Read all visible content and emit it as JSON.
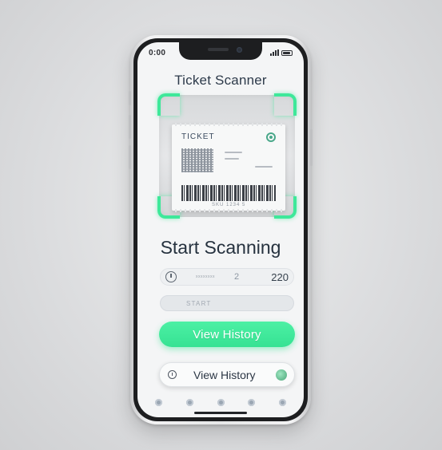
{
  "status_bar": {
    "time": "0:00",
    "icons": [
      "signal-icon",
      "battery-icon"
    ]
  },
  "app": {
    "title": "Ticket Scanner"
  },
  "scanner": {
    "ticket_label": "TICKET",
    "barcode_digits": "SKU 1234 5"
  },
  "headline": "Start Scanning",
  "info_row": {
    "label": "xxxxxxxx",
    "count": "2",
    "value": "220"
  },
  "start_input": {
    "placeholder": "START"
  },
  "buttons": {
    "primary_label": "View History",
    "secondary_label": "View History"
  },
  "colors": {
    "accent": "#3ee89a",
    "text_dark": "#26323f"
  }
}
